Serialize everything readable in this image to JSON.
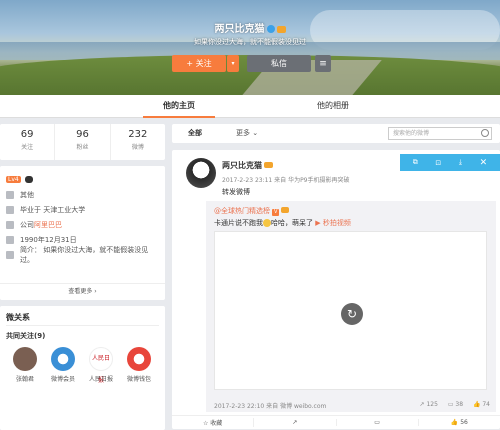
{
  "profile": {
    "nickname": "两只比克猫",
    "motto": "如果你没过大海，就不能假装没见过",
    "follow_label": "+ 关注",
    "message_label": "私信",
    "more_label": "≡"
  },
  "tabs": [
    {
      "label": "他的主页"
    },
    {
      "label": "他的相册"
    }
  ],
  "stats": [
    {
      "num": "69",
      "label": "关注"
    },
    {
      "num": "96",
      "label": "粉丝"
    },
    {
      "num": "232",
      "label": "微博"
    }
  ],
  "info": {
    "level": "Lv4",
    "gender": "其他",
    "school": "毕业于 天津工业大学",
    "company_prefix": "公司 ",
    "company_link": "阿里巴巴",
    "birthday": "1990年12月31日",
    "intro": "简介：  如果你没过大海，就不能假装没见过。",
    "more": "查看更多 ›"
  },
  "relations": {
    "title": "微关系",
    "common_follow": "共同关注(9)",
    "users": [
      {
        "name": "张翰君",
        "color": "#7a5f52"
      },
      {
        "name": "微博会员",
        "color": "#3a8fd6"
      },
      {
        "name": "人民日报",
        "color": "#ffffff"
      },
      {
        "name": "微博钱包",
        "color": "#e8463b"
      }
    ]
  },
  "filter": {
    "all": "全部",
    "more": "更多 ⌄",
    "search_placeholder": "搜索他的微博"
  },
  "post": {
    "nickname": "两只比克猫",
    "meta": "2017-2-23 23:11 来自 华为P9手机摄影再突破",
    "text": "转发微博",
    "toolbar": [
      "⧉",
      "⊡",
      "⤓",
      "✕"
    ],
    "repost": {
      "src_user": "@全球热门精选榜",
      "vv": "V",
      "text_a": "卡通片说不跑我",
      "text_b": "哈哈，萌呆了",
      "video_link": "秒拍视频",
      "foot_time": "2017-2-23 22:10 来自 微博 weibo.com",
      "acts": [
        "↗ 125",
        "▭ 38",
        "👍 74"
      ]
    },
    "actions": [
      "☆ 收藏",
      "↗",
      "▭",
      "👍 56"
    ]
  }
}
